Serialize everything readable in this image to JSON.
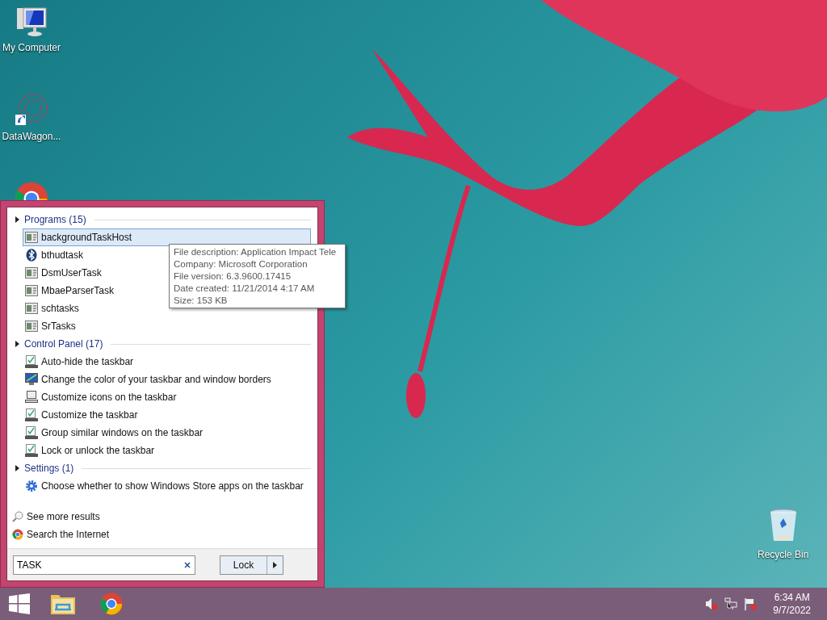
{
  "desktop_icons": [
    {
      "label": "My Computer",
      "kind": "computer"
    },
    {
      "label": "DataWagon...",
      "kind": "shortcut"
    },
    {
      "kind": "chrome"
    }
  ],
  "recycle_bin": {
    "label": "Recycle Bin"
  },
  "start_menu": {
    "groups": [
      {
        "title": "Programs (15)",
        "items": [
          {
            "label": "backgroundTaskHost",
            "kind": "app",
            "selected": true
          },
          {
            "label": "bthudtask",
            "kind": "bluetooth",
            "selected": false
          },
          {
            "label": "DsmUserTask",
            "kind": "app",
            "selected": false
          },
          {
            "label": "MbaeParserTask",
            "kind": "app",
            "selected": false
          },
          {
            "label": "schtasks",
            "kind": "app",
            "selected": false
          },
          {
            "label": "SrTasks",
            "kind": "app",
            "selected": false
          }
        ]
      },
      {
        "title": "Control Panel (17)",
        "items": [
          {
            "label": "Auto-hide the taskbar",
            "kind": "checkbox",
            "selected": false
          },
          {
            "label": "Change the color of your taskbar and window borders",
            "kind": "color",
            "selected": false
          },
          {
            "label": "Customize icons on the taskbar",
            "kind": "monitor",
            "selected": false
          },
          {
            "label": "Customize the taskbar",
            "kind": "checkbox",
            "selected": false
          },
          {
            "label": "Group similar windows on the taskbar",
            "kind": "checkbox",
            "selected": false
          },
          {
            "label": "Lock or unlock the taskbar",
            "kind": "checkbox",
            "selected": false
          }
        ]
      },
      {
        "title": "Settings (1)",
        "items": [
          {
            "label": "Choose whether to show Windows Store apps on the taskbar",
            "kind": "gear",
            "selected": false
          }
        ]
      }
    ],
    "links": [
      {
        "label": "See more results",
        "kind": "search"
      },
      {
        "label": "Search the Internet",
        "kind": "chrome"
      }
    ],
    "search": {
      "value": "TASK"
    },
    "power_button": {
      "label": "Lock"
    }
  },
  "tooltip": {
    "lines": [
      "File description: Application Impact Tele",
      "Company: Microsoft Corporation",
      "File version: 6.3.9600.17415",
      "Date created: 11/21/2014 4:17 AM",
      "Size: 153 KB"
    ]
  },
  "taskbar": {
    "pinned": [
      {
        "kind": "windows"
      },
      {
        "kind": "folder"
      },
      {
        "kind": "chrome"
      }
    ],
    "tray": [
      {
        "kind": "speaker"
      },
      {
        "kind": "network"
      },
      {
        "kind": "flag"
      }
    ],
    "clock": {
      "time": "6:34 AM",
      "date": "9/7/2022"
    }
  }
}
